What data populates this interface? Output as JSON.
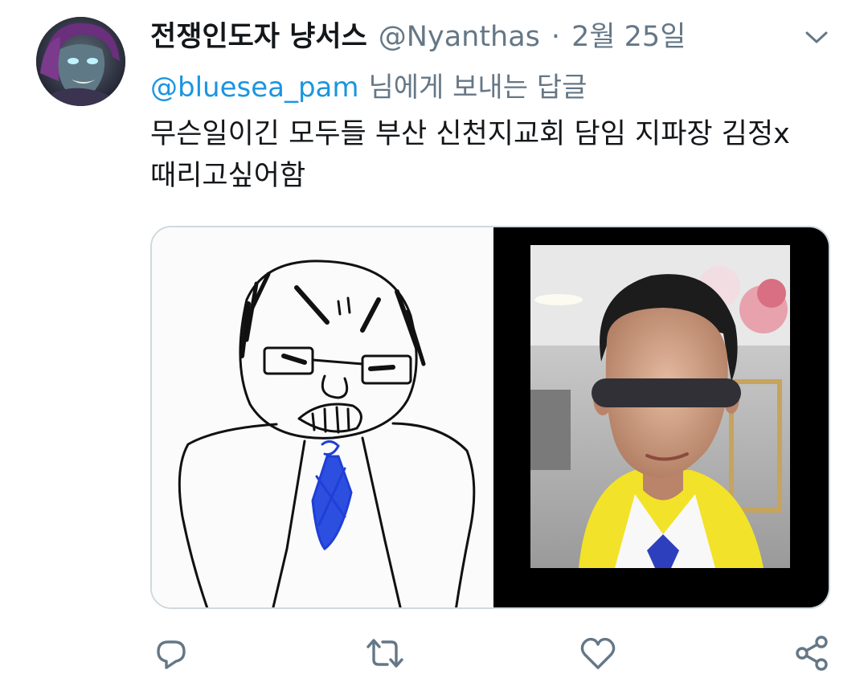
{
  "tweet": {
    "display_name": "전쟁인도자 냥서스",
    "handle": "@Nyanthas",
    "separator": "·",
    "timestamp": "2월 25일",
    "reply_to": {
      "mention": "@bluesea_pam",
      "suffix": "님에게 보내는 답글"
    },
    "text": "무슨일이긴 모두들 부산 신천지교회 담임 지파장 김정x 때리고싶어함"
  },
  "icons": {
    "menu": "chevron-down-icon",
    "reply": "reply-icon",
    "retweet": "retweet-icon",
    "like": "heart-icon",
    "share": "share-icon"
  },
  "colors": {
    "text": "#14171a",
    "secondary": "#657786",
    "link": "#1b95e0",
    "border": "#cfd9de"
  }
}
